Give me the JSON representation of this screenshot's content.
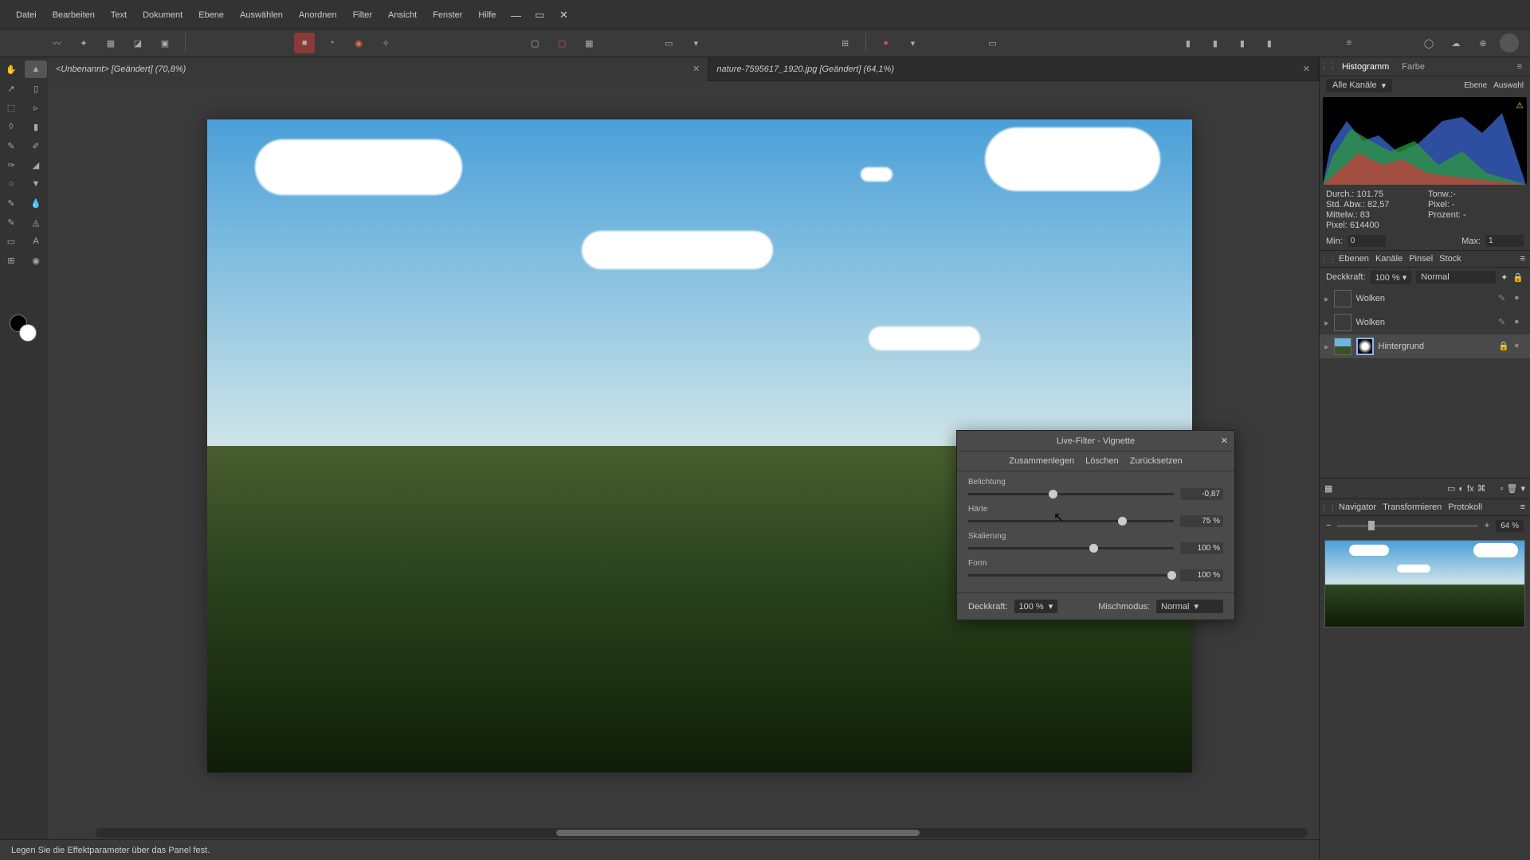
{
  "menu": [
    "Datei",
    "Bearbeiten",
    "Text",
    "Dokument",
    "Ebene",
    "Auswählen",
    "Anordnen",
    "Filter",
    "Ansicht",
    "Fenster",
    "Hilfe"
  ],
  "tabs": [
    {
      "label": "<Unbenannt> [Geändert] (70,8%)",
      "active": true
    },
    {
      "label": "nature-7595617_1920.jpg [Geändert] (64,1%)",
      "active": false
    }
  ],
  "statusbar": "Legen Sie die Effektparameter über das Panel fest.",
  "rpanel": {
    "htabs": [
      "Histogramm",
      "Farbe"
    ],
    "channel": "Alle Kanäle",
    "htop_right": [
      "Ebene",
      "Auswahl"
    ],
    "stats": {
      "durch": "Durch.: 101.75",
      "std": "Std. Abw.: 82,57",
      "mittelw": "Mittelw.: 83",
      "pixel": "Pixel: 614400",
      "tonw": "Tonw.:-",
      "pixel2": "Pixel: -",
      "prozent": "Prozent: -"
    },
    "min_label": "Min:",
    "min_val": "0",
    "max_label": "Max:",
    "max_val": "1",
    "ltabs": [
      "Ebenen",
      "Kanäle",
      "Pinsel",
      "Stock"
    ],
    "opacity_label": "Deckkraft:",
    "opacity_val": "100 %",
    "blend": "Normal",
    "layers": [
      {
        "name": "Wolken",
        "type": "cloud"
      },
      {
        "name": "Wolken",
        "type": "cloud"
      },
      {
        "name": "Hintergrund",
        "type": "bg",
        "selected": true,
        "locked": true
      }
    ],
    "ntabs": [
      "Navigator",
      "Transformieren",
      "Protokoll"
    ],
    "zoom": "64 %"
  },
  "dialog": {
    "title": "Live-Filter - Vignette",
    "actions": [
      "Zusammenlegen",
      "Löschen",
      "Zurücksetzen"
    ],
    "sliders": [
      {
        "label": "Belichtung",
        "value": "-0,87",
        "pos": 39
      },
      {
        "label": "Härte",
        "value": "75 %",
        "pos": 73
      },
      {
        "label": "Skalierung",
        "value": "100 %",
        "pos": 59
      },
      {
        "label": "Form",
        "value": "100 %",
        "pos": 97
      }
    ],
    "opacity_label": "Deckkraft:",
    "opacity": "100 %",
    "blend_label": "Mischmodus:",
    "blend": "Normal"
  }
}
